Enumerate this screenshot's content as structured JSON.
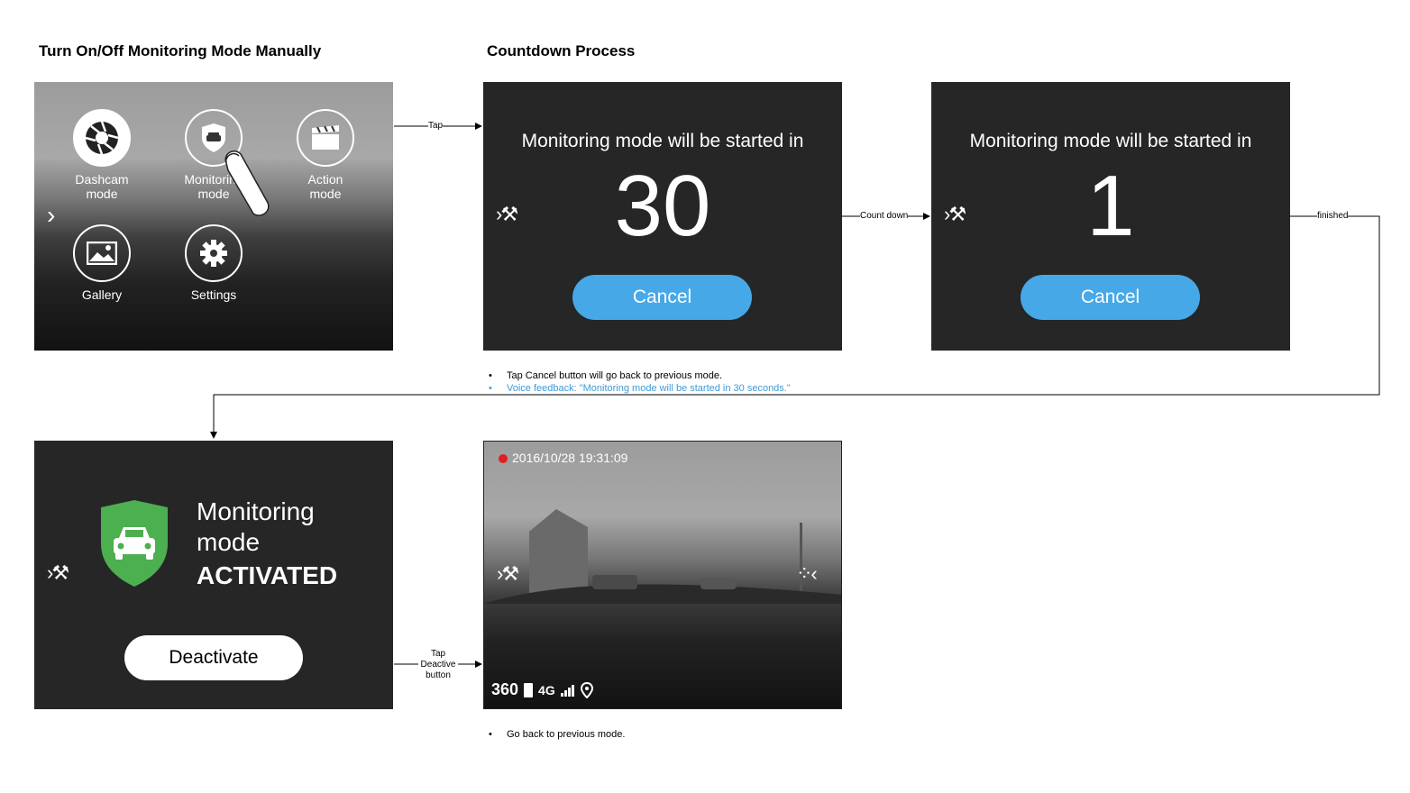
{
  "titles": {
    "left": "Turn On/Off Monitoring Mode Manually",
    "right": "Countdown Process"
  },
  "menu_screen": {
    "items": [
      {
        "label_line1": "Dashcam",
        "label_line2": "mode",
        "icon": "aperture-icon"
      },
      {
        "label_line1": "Monitoring",
        "label_line2": "mode",
        "icon": "shield-car-icon"
      },
      {
        "label_line1": "Action",
        "label_line2": "mode",
        "icon": "clapperboard-icon"
      },
      {
        "label_line1": "Gallery",
        "label_line2": "",
        "icon": "image-icon"
      },
      {
        "label_line1": "Settings",
        "label_line2": "",
        "icon": "gear-icon"
      }
    ]
  },
  "countdown": {
    "message": "Monitoring mode will be started in",
    "first_value": "30",
    "last_value": "1",
    "cancel_label": "Cancel"
  },
  "arrows": {
    "tap": "Tap",
    "count_down": "Count down",
    "finished": "finished",
    "tap_deactive_1": "Tap",
    "tap_deactive_2": "Deactive",
    "tap_deactive_3": "button"
  },
  "notes": {
    "cancel_note": "Tap Cancel button will go back to previous mode.",
    "voice_note": "Voice feedback: \"Monitoring mode will be started in 30 seconds.\"",
    "back_note": "Go back to previous mode."
  },
  "activated_screen": {
    "line1": "Monitoring",
    "line2": "mode",
    "line3": "ACTIVATED",
    "deactivate_label": "Deactivate"
  },
  "camera_screen": {
    "timestamp": "2016/10/28 19:31:09",
    "badge_360": "360",
    "network": "4G"
  },
  "colors": {
    "screen_bg": "#262626",
    "cancel_blue": "#47a8e8",
    "shield_green": "#4caf50",
    "rec_red": "#e02020",
    "note_blue": "#3d9ad8"
  }
}
